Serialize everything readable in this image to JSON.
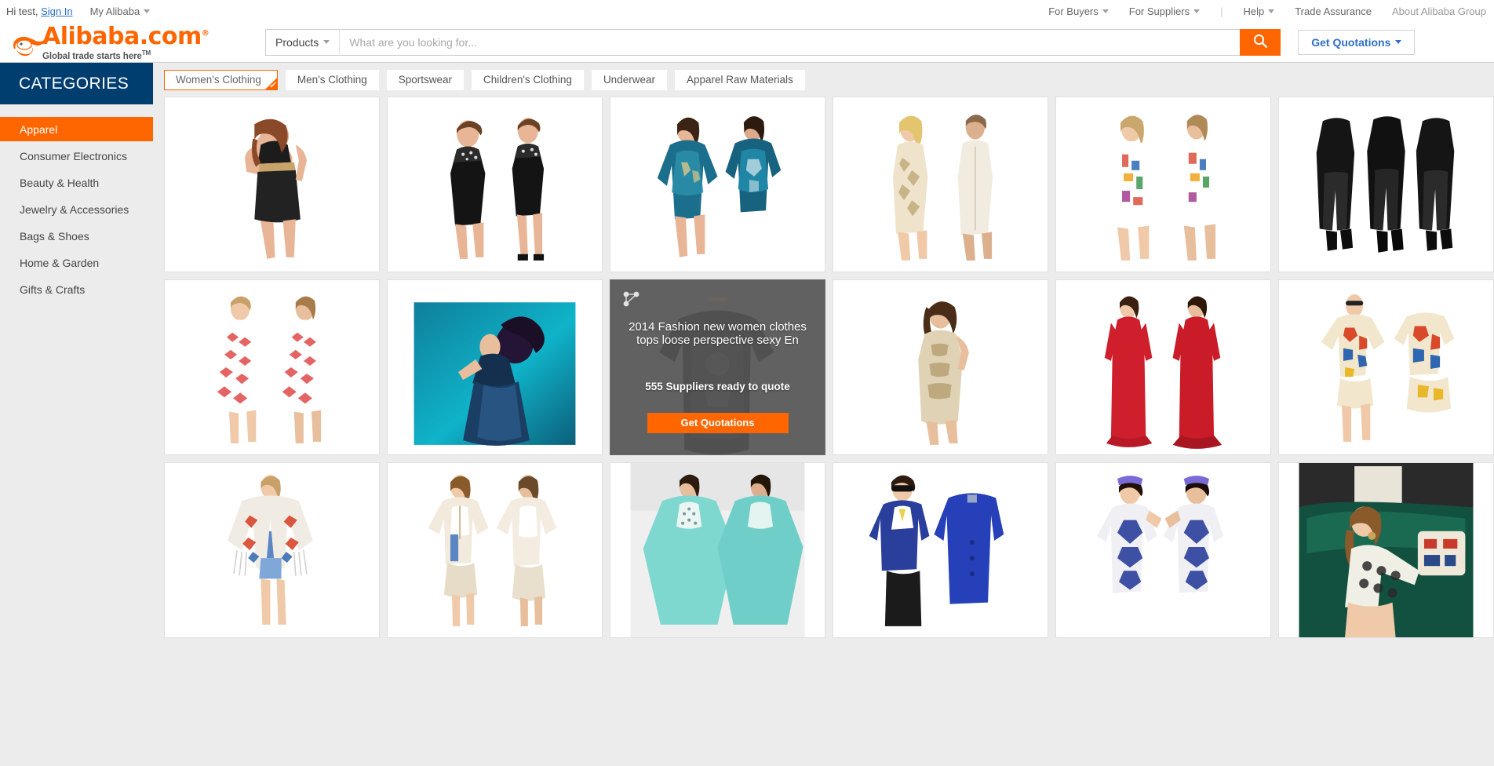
{
  "topbar": {
    "greeting": "Hi test,",
    "sign_in": "Sign In",
    "my_alibaba": "My Alibaba",
    "right_items": [
      {
        "label": "For Buyers",
        "has_caret": true,
        "muted": false
      },
      {
        "label": "For Suppliers",
        "has_caret": true,
        "muted": false
      },
      {
        "label": "Help",
        "has_caret": true,
        "muted": false
      },
      {
        "label": "Trade Assurance",
        "has_caret": false,
        "muted": false
      },
      {
        "label": "About Alibaba Group",
        "has_caret": false,
        "muted": true
      }
    ]
  },
  "logo": {
    "name": "Alibaba",
    "domain": ".com",
    "registered": "®",
    "tagline": "Global trade starts here",
    "tm": "TM"
  },
  "search": {
    "category_label": "Products",
    "placeholder": "What are you looking for...",
    "value": "",
    "search_icon": "search-icon",
    "quote_label": "Get Quotations"
  },
  "sidebar": {
    "title": "CATEGORIES",
    "items": [
      {
        "label": "Apparel",
        "active": true
      },
      {
        "label": "Consumer Electronics",
        "active": false
      },
      {
        "label": "Beauty & Health",
        "active": false
      },
      {
        "label": "Jewelry & Accessories",
        "active": false
      },
      {
        "label": "Bags & Shoes",
        "active": false
      },
      {
        "label": "Home & Garden",
        "active": false
      },
      {
        "label": "Gifts & Crafts",
        "active": false
      }
    ]
  },
  "tabs": [
    {
      "label": "Women's Clothing",
      "active": true
    },
    {
      "label": "Men's Clothing",
      "active": false
    },
    {
      "label": "Sportswear",
      "active": false
    },
    {
      "label": "Children's Clothing",
      "active": false
    },
    {
      "label": "Underwear",
      "active": false
    },
    {
      "label": "Apparel Raw Materials",
      "active": false
    }
  ],
  "overlay_card": {
    "title": "2014 Fashion new women clothes tops loose perspective sexy En",
    "suppliers_text": "555 Suppliers ready to quote",
    "button_label": "Get Quotations",
    "share_icon": "share-network-icon"
  },
  "colors": {
    "brand_orange": "#ff6600",
    "navy": "#003e70",
    "link_blue": "#2e6fc7",
    "page_bg": "#ececec",
    "overlay_gray": "#6b6b6b"
  }
}
